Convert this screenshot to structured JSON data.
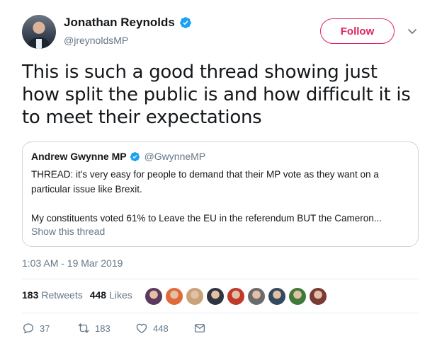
{
  "author": {
    "display_name": "Jonathan Reynolds",
    "handle": "@jreynoldsMP",
    "verified": true
  },
  "follow_label": "Follow",
  "tweet_text": "This is such a good thread showing just how split the public is and how difficult it is to meet their expectations",
  "quoted": {
    "display_name": "Andrew Gwynne MP",
    "handle": "@GwynneMP",
    "paragraph1": "THREAD: it's very easy for people to demand that their MP vote as they want on a particular issue like Brexit.",
    "paragraph2": "My constituents voted 61% to Leave the EU in the referendum BUT the Cameron...",
    "show_thread": "Show this thread"
  },
  "timestamp": "1:03 AM - 19 Mar 2019",
  "stats": {
    "retweets_count": "183",
    "retweets_label": "Retweets",
    "likes_count": "448",
    "likes_label": "Likes"
  },
  "liker_avatar_colors": [
    "#5b3a5e",
    "#e06a3a",
    "#c9a27a",
    "#2f3440",
    "#c0392b",
    "#6b6b6b",
    "#34495e",
    "#3f7a3a",
    "#7a3b35"
  ],
  "actions": {
    "replies": "37",
    "retweets": "183",
    "likes": "448"
  },
  "colors": {
    "follow_accent": "#e0245e",
    "verified_blue": "#1da1f2",
    "secondary_text": "#657786"
  }
}
